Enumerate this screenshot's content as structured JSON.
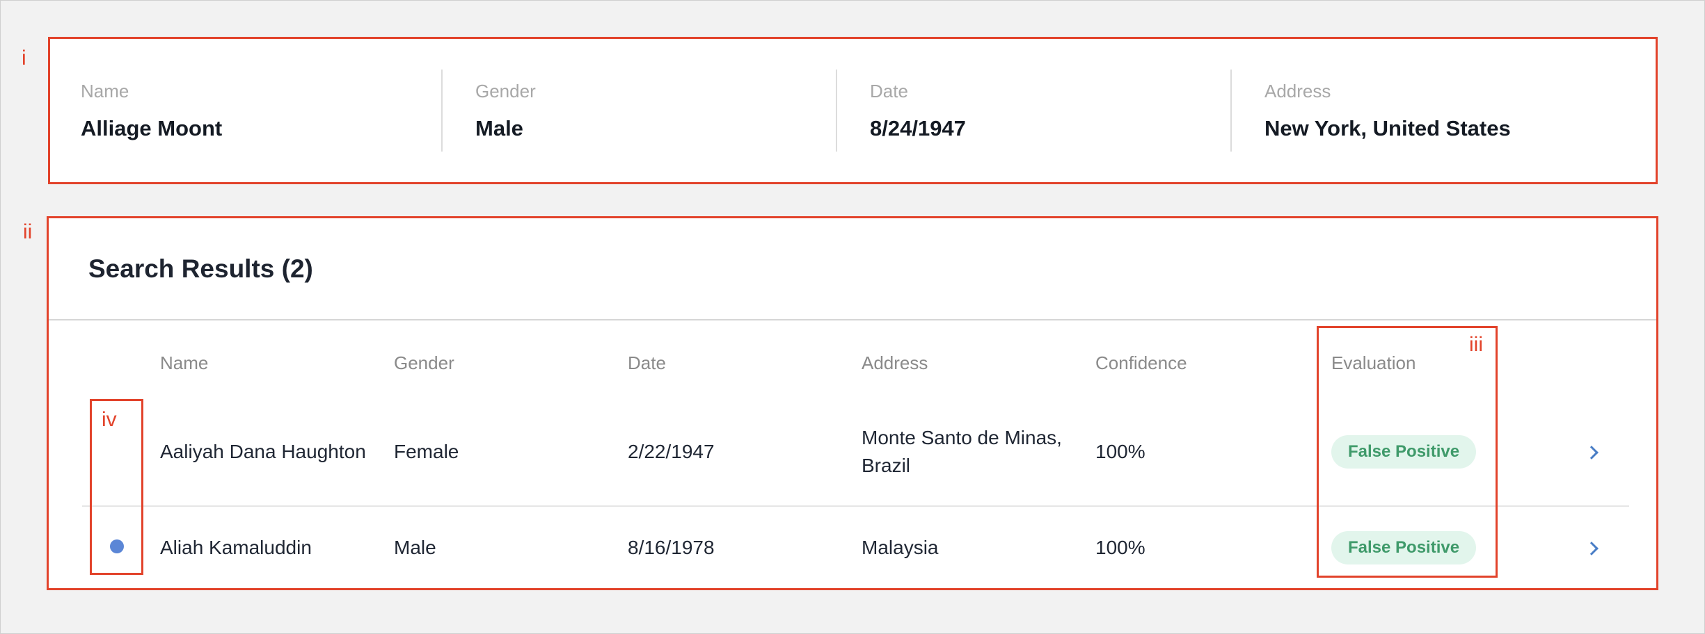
{
  "annotations": {
    "panel_i": "i",
    "panel_ii": "ii",
    "evaluation_column": "iii",
    "indicator_column": "iv"
  },
  "subject": {
    "name_label": "Name",
    "name_value": "Alliage Moont",
    "gender_label": "Gender",
    "gender_value": "Male",
    "date_label": "Date",
    "date_value": "8/24/1947",
    "address_label": "Address",
    "address_value": "New York, United States"
  },
  "results": {
    "title": "Search Results (2)",
    "columns": [
      "Name",
      "Gender",
      "Date",
      "Address",
      "Confidence",
      "Evaluation"
    ],
    "rows": [
      {
        "name": "Aaliyah Dana Haughton",
        "gender": "Female",
        "date": "2/22/1947",
        "address_line1": "Monte Santo de Minas,",
        "address_line2": "Brazil",
        "confidence": "100%",
        "evaluation": "False Positive",
        "unread": false
      },
      {
        "name": "Aliah Kamaluddin",
        "gender": "Male",
        "date": "8/16/1978",
        "address_line1": "Malaysia",
        "address_line2": "",
        "confidence": "100%",
        "evaluation": "False Positive",
        "unread": true
      }
    ]
  },
  "colors": {
    "annotation": "#e2432b",
    "badge_bg": "#e2f5ec",
    "badge_text": "#3f9a6a",
    "link": "#4a7ec6",
    "unread_dot": "#5b86d6"
  }
}
